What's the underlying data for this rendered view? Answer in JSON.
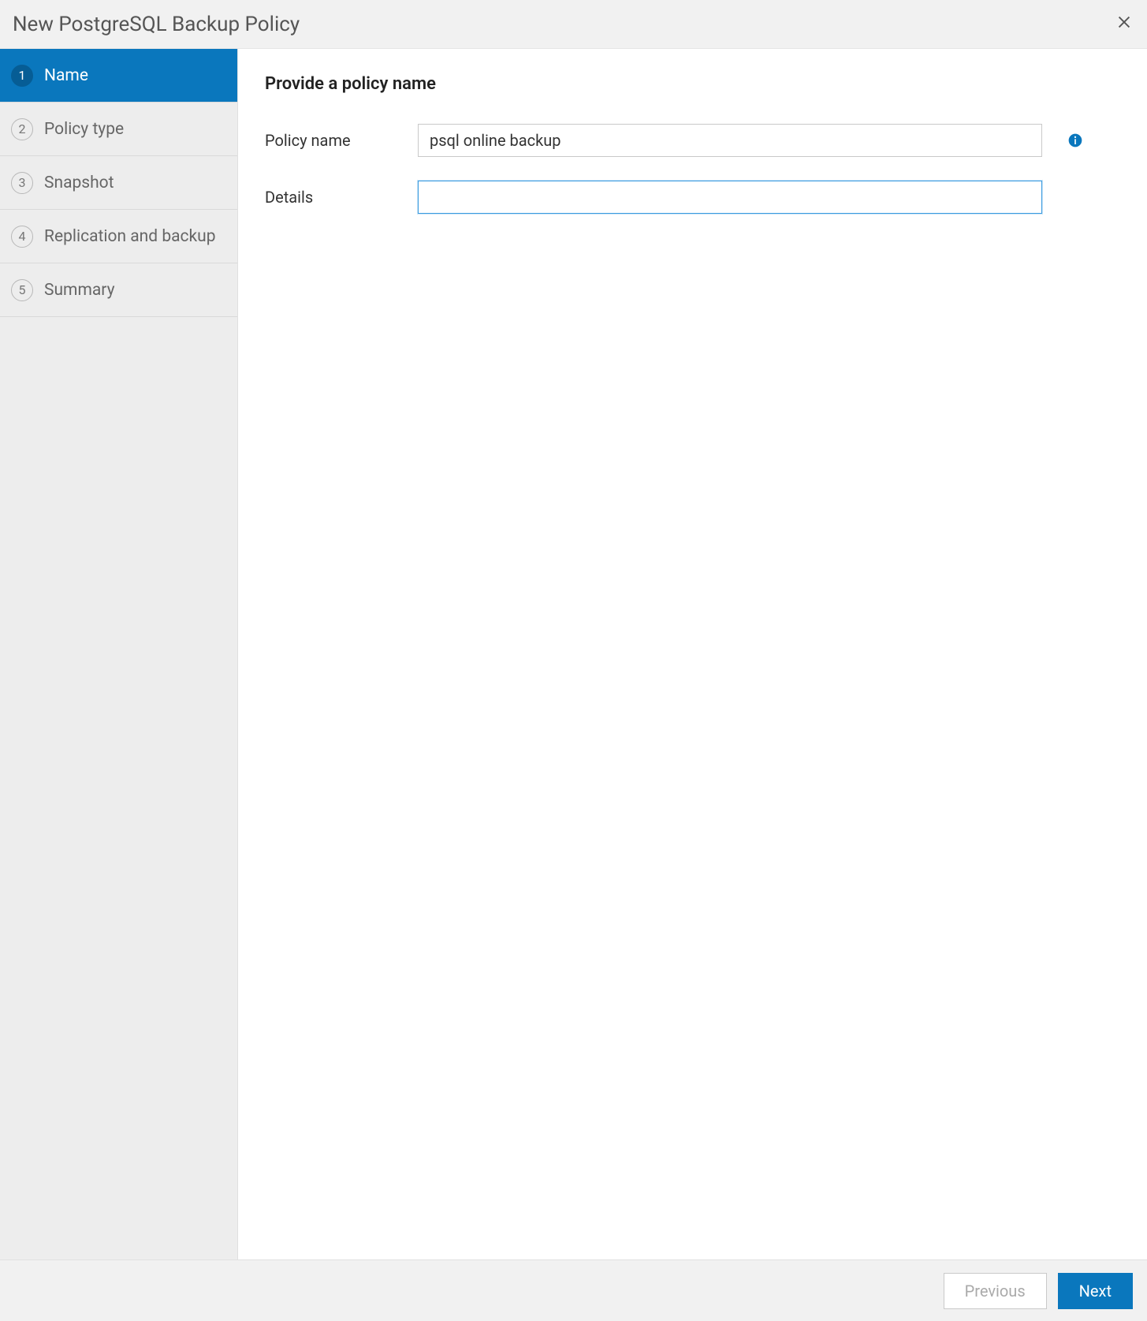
{
  "header": {
    "title": "New PostgreSQL Backup Policy"
  },
  "sidebar": {
    "steps": [
      {
        "num": "1",
        "label": "Name",
        "active": true
      },
      {
        "num": "2",
        "label": "Policy type",
        "active": false
      },
      {
        "num": "3",
        "label": "Snapshot",
        "active": false
      },
      {
        "num": "4",
        "label": "Replication and backup",
        "active": false
      },
      {
        "num": "5",
        "label": "Summary",
        "active": false
      }
    ]
  },
  "main": {
    "heading": "Provide a policy name",
    "policy_name_label": "Policy name",
    "policy_name_value": "psql online backup",
    "details_label": "Details",
    "details_value": ""
  },
  "footer": {
    "previous_label": "Previous",
    "next_label": "Next"
  }
}
